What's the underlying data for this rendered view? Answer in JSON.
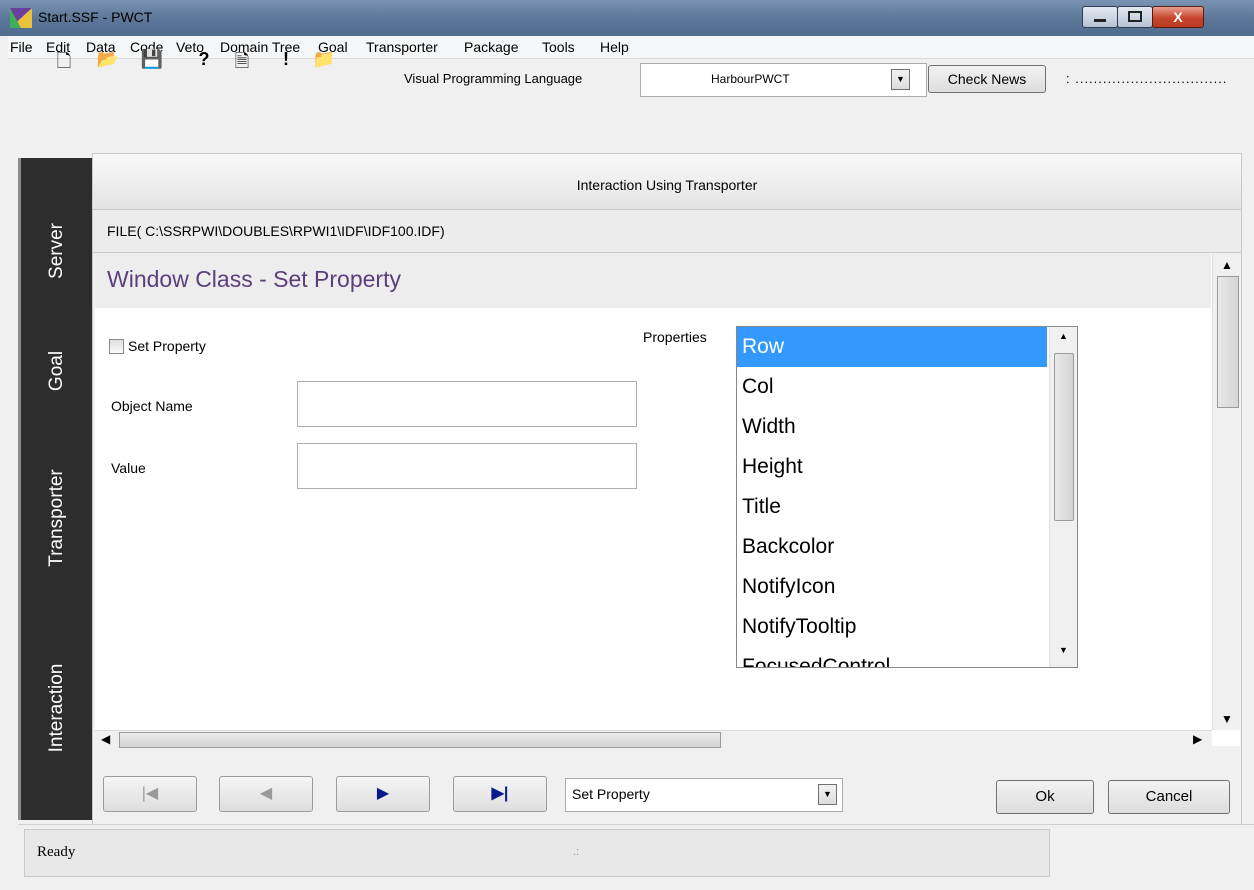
{
  "window": {
    "title": "Start.SSF  - PWCT",
    "close_glyph": "X"
  },
  "menu": [
    "File",
    "Edit",
    "Data",
    "Code",
    "Veto",
    "Domain Tree",
    "Goal",
    "Transporter",
    "Package",
    "Tools",
    "Help"
  ],
  "toolbar": {
    "icons": [
      "new-file-icon",
      "open-folder-icon",
      "save-icon",
      "help-icon",
      "document-icon",
      "exclamation-icon",
      "open-icon"
    ],
    "glyphs": [
      "🗋",
      "📂",
      "💾",
      "?",
      "🗎",
      "!",
      "📁"
    ],
    "vpl_label": "Visual Programming Language",
    "vpl_value": "HarbourPWCT",
    "check_news": "Check News",
    "rest_text": ": ................................."
  },
  "side_tabs": [
    "Server",
    "Goal",
    "Transporter",
    "Interaction"
  ],
  "header": {
    "title": "Interaction Using Transporter"
  },
  "file_path": "FILE( C:\\SSRPWI\\DOUBLES\\RPWI1\\IDF\\IDF100.IDF)",
  "form": {
    "title": "Window Class - Set Property",
    "checkbox_label": "Set Property",
    "object_name_label": "Object Name",
    "object_name_value": "",
    "value_label": "Value",
    "value_value": "",
    "properties_label": "Properties",
    "properties": [
      "Row",
      "Col",
      "Width",
      "Height",
      "Title",
      "Backcolor",
      "NotifyIcon",
      "NotifyTooltip",
      "FocusedControl"
    ],
    "selected_property": "Row"
  },
  "nav": {
    "first_glyph": "|◀",
    "prev_glyph": "◀",
    "next_glyph": "▶",
    "last_glyph": "▶|",
    "combo_value": "Set Property",
    "ok": "Ok",
    "cancel": "Cancel"
  },
  "status": {
    "text": "Ready"
  },
  "colors": {
    "title_purple": "#5b3f7c",
    "selection_blue": "#3399ff",
    "side_dark": "#2d2d2d"
  }
}
